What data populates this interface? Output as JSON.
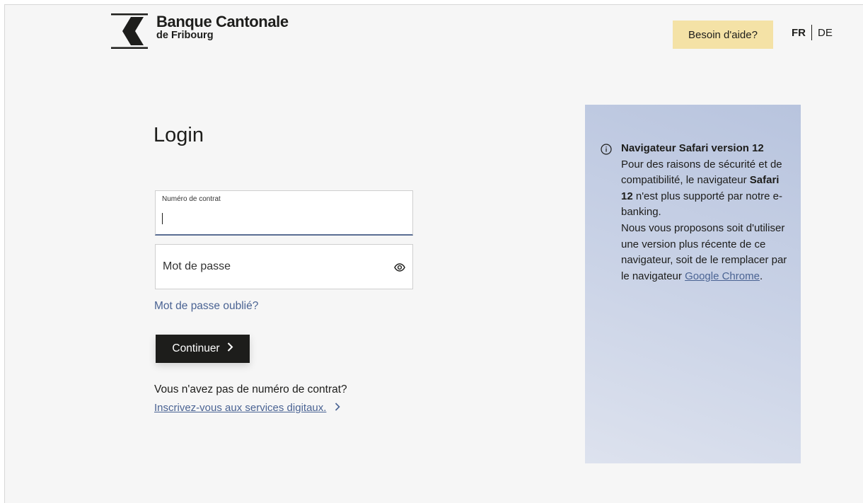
{
  "header": {
    "logo_title": "Banque Cantonale",
    "logo_subtitle": "de Fribourg",
    "help_label": "Besoin d'aide?",
    "lang_active": "FR",
    "lang_other": "DE"
  },
  "login": {
    "title": "Login",
    "contract_label": "Numéro de contrat",
    "contract_value": "",
    "password_placeholder": "Mot de passe",
    "forgot_password": "Mot de passe oublié?",
    "continue_label": "Continuer",
    "no_contract_text": "Vous n'avez pas de numéro de contrat?",
    "register_link": "Inscrivez-vous aux services digitaux."
  },
  "info": {
    "title": "Navigateur Safari version 12",
    "p1_a": "Pour des raisons de sécurité et de compatibilité, le navigateur ",
    "p1_bold": "Safari 12",
    "p1_b": " n'est plus supporté par notre e-banking.",
    "p2_a": "Nous vous proposons soit d'utiliser une version plus récente de ce navigateur, soit de le remplacer par le navigateur ",
    "p2_link": "Google Chrome",
    "p2_b": "."
  },
  "icons": {
    "logo": "bcf-chevron-logo",
    "password_toggle": "eye-icon",
    "info": "info-circle-icon",
    "chevron": "chevron-right-icon"
  },
  "colors": {
    "accent_link": "#4a6393",
    "help_button": "#f4e2a6",
    "primary_button": "#1d1d1b",
    "info_panel": "#c3cde4"
  }
}
